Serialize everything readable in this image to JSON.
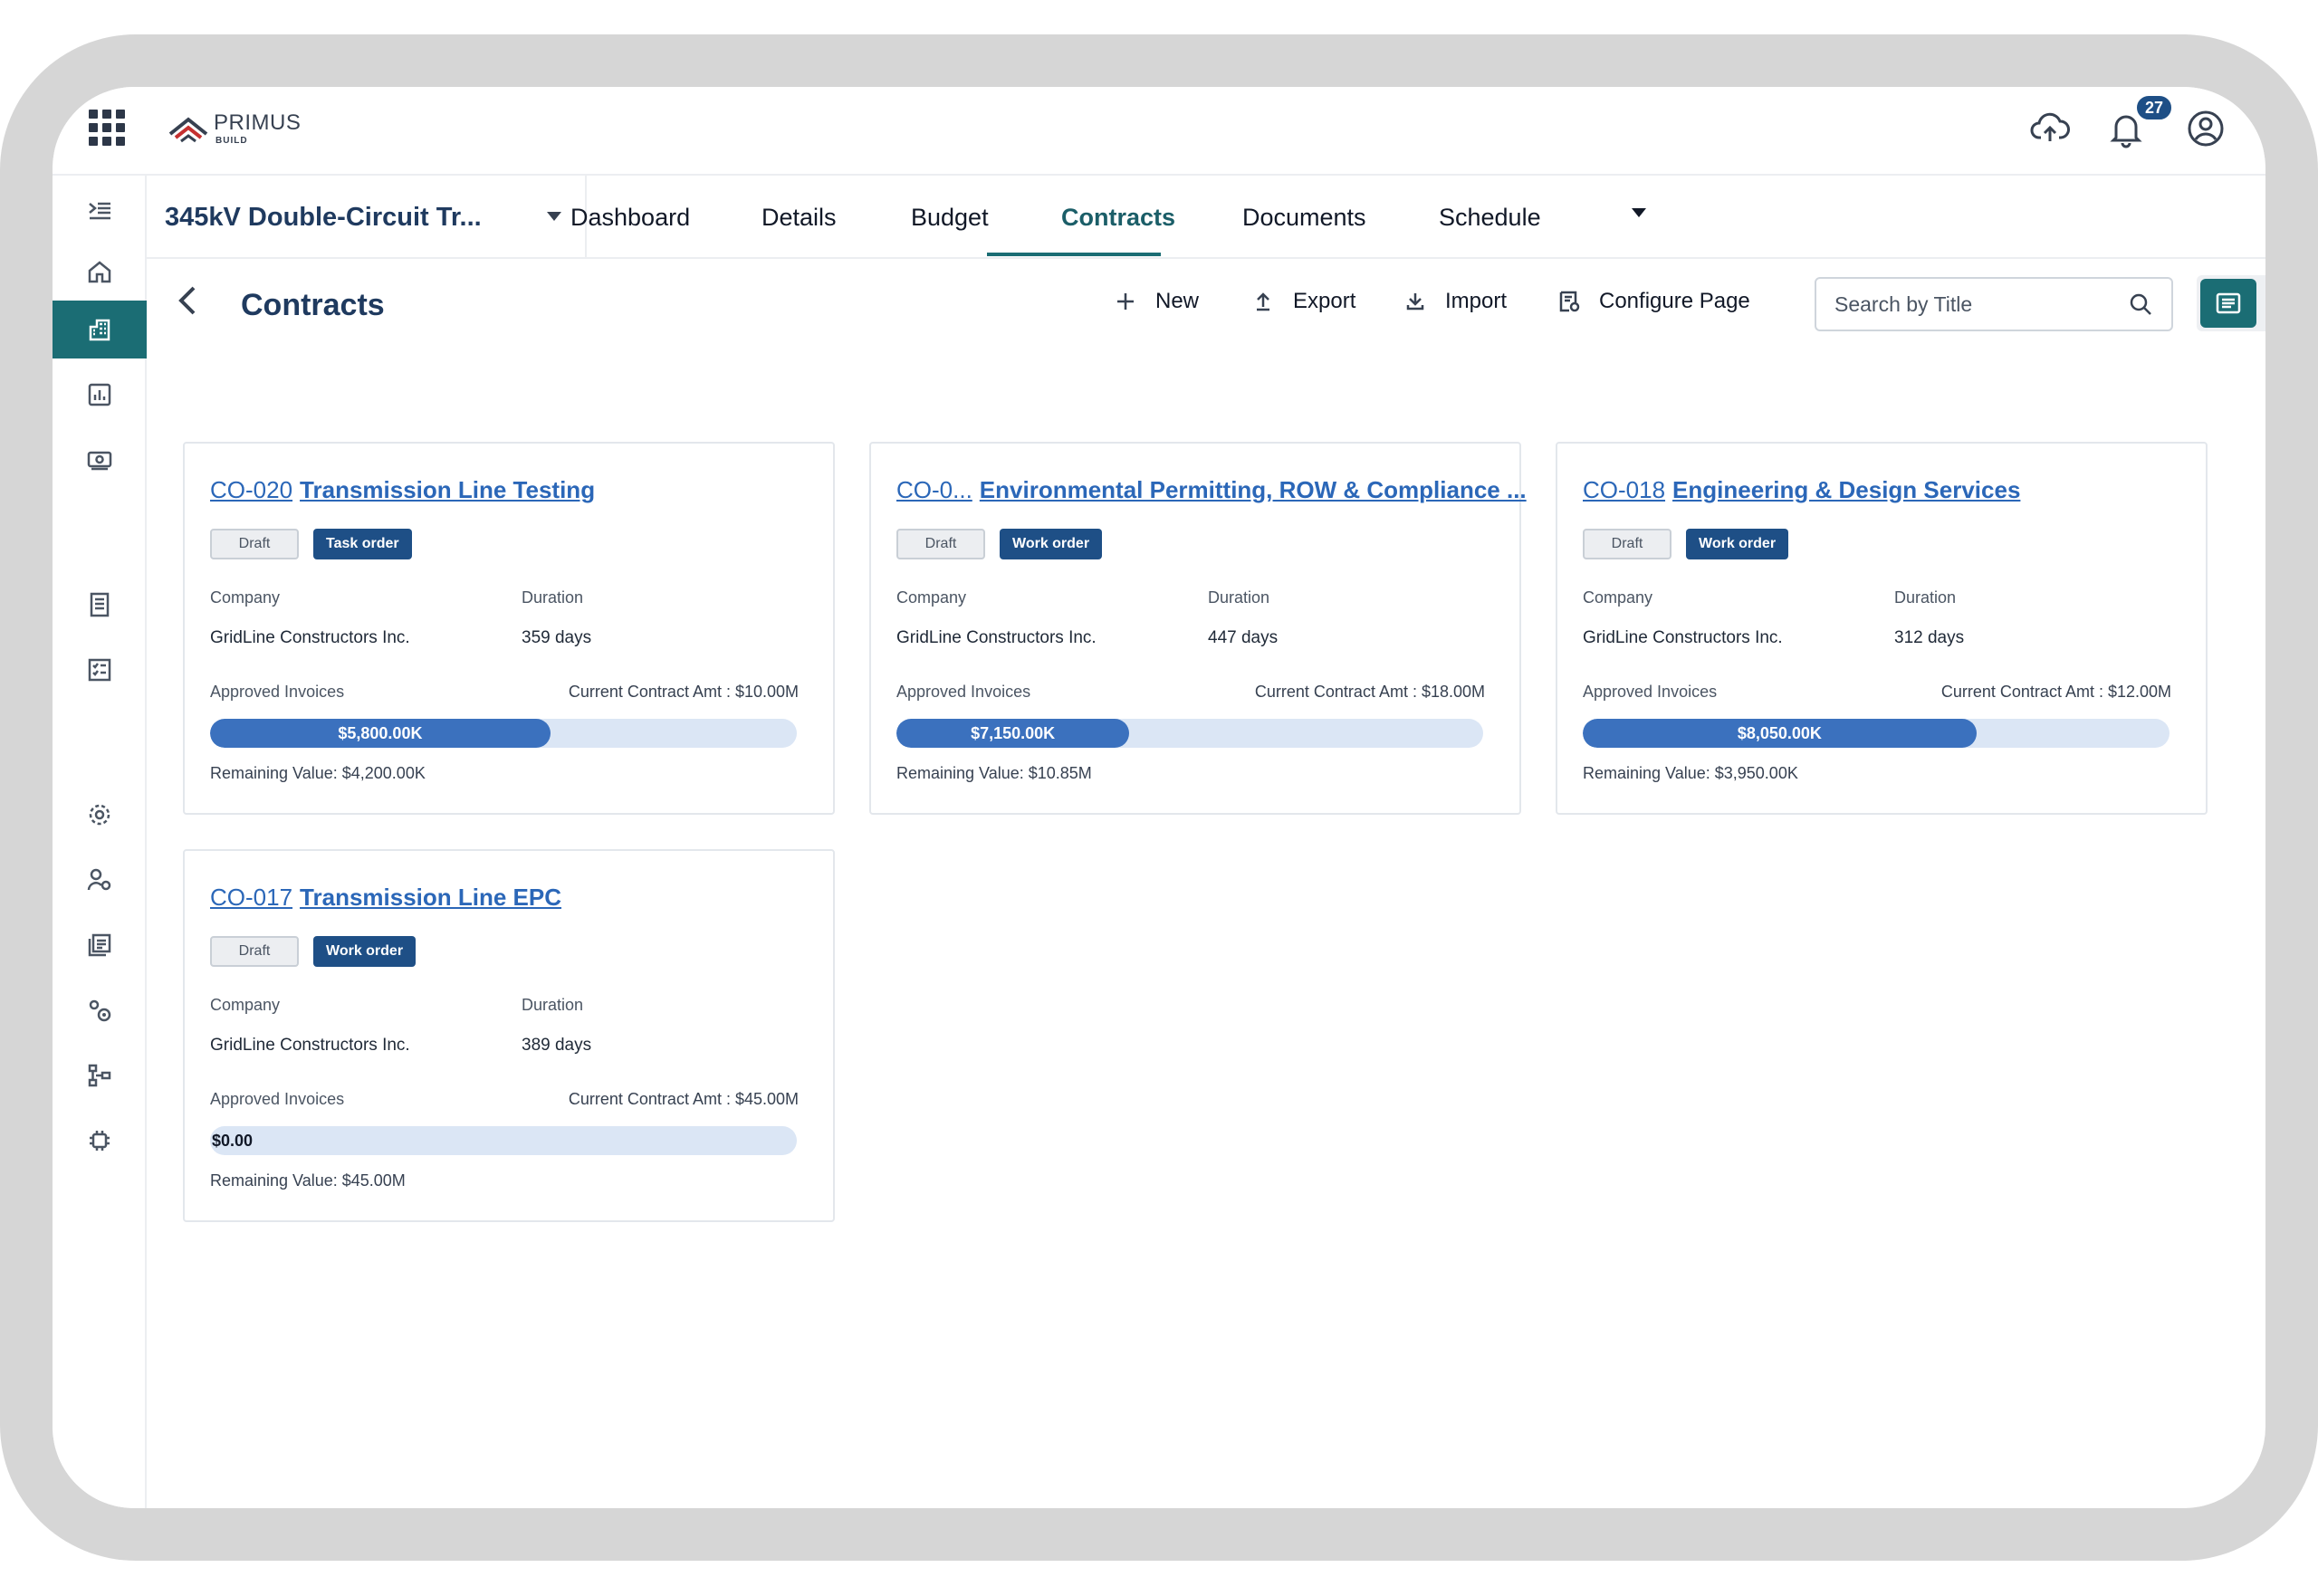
{
  "header": {
    "logo_name": "PRIMUS",
    "logo_sub": "BUILD",
    "notification_count": "27"
  },
  "project": {
    "title": "345kV Double-Circuit Tr..."
  },
  "tabs": [
    {
      "label": "Dashboard"
    },
    {
      "label": "Details"
    },
    {
      "label": "Budget"
    },
    {
      "label": "Contracts",
      "active": true
    },
    {
      "label": "Documents"
    },
    {
      "label": "Schedule"
    }
  ],
  "page": {
    "title": "Contracts",
    "actions": {
      "new": "New",
      "export": "Export",
      "import": "Import",
      "configure": "Configure Page"
    },
    "search_placeholder": "Search by Title"
  },
  "labels": {
    "company": "Company",
    "duration": "Duration",
    "approved_invoices": "Approved Invoices"
  },
  "contracts": [
    {
      "code": "CO-020",
      "name": "Transmission Line Testing",
      "status": "Draft",
      "type": "Task order",
      "company": "GridLine Constructors Inc.",
      "duration": "359 days",
      "current_amt": "Current Contract Amt : $10.00M",
      "approved": "$5,800.00K",
      "progress": 0.58,
      "remaining": "Remaining Value: $4,200.00K"
    },
    {
      "code": "CO-0...",
      "name": "Environmental Permitting, ROW & Compliance ...",
      "status": "Draft",
      "type": "Work order",
      "company": "GridLine Constructors Inc.",
      "duration": "447 days",
      "current_amt": "Current Contract Amt : $18.00M",
      "approved": "$7,150.00K",
      "progress": 0.397,
      "remaining": "Remaining Value: $10.85M"
    },
    {
      "code": "CO-018",
      "name": "Engineering & Design Services",
      "status": "Draft",
      "type": "Work order",
      "company": "GridLine Constructors Inc.",
      "duration": "312 days",
      "current_amt": "Current Contract Amt : $12.00M",
      "approved": "$8,050.00K",
      "progress": 0.671,
      "remaining": "Remaining Value: $3,950.00K"
    },
    {
      "code": "CO-017",
      "name": "Transmission Line EPC",
      "status": "Draft",
      "type": "Work order",
      "company": "GridLine Constructors Inc.",
      "duration": "389 days",
      "current_amt": "Current Contract Amt : $45.00M",
      "approved": "$0.00",
      "progress": 0,
      "remaining": "Remaining Value: $45.00M"
    }
  ],
  "colors": {
    "accent": "#1b6d74",
    "link": "#2b67b8",
    "chip": "#1e4f86",
    "bar_fill": "#3b71be",
    "bar_track": "#dbe6f5"
  }
}
